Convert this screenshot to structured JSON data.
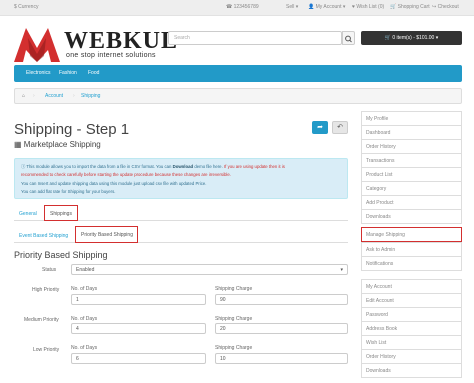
{
  "topbar": {
    "currency": "$ Currency",
    "phone": "123456789",
    "sell": "Sell",
    "account": "My Account",
    "wishlist": "Wish List (0)",
    "cart": "Shopping Cart",
    "checkout": "Checkout"
  },
  "brand": {
    "name": "WEBKUL",
    "tagline": "one stop internet solutions",
    "color": "#d32f2f"
  },
  "search": {
    "placeholder": "Search"
  },
  "cart_button": "0 item(s) - $101.00",
  "menu": [
    "Electronics",
    "Fashion",
    "Food"
  ],
  "breadcrumb": [
    "Account",
    "Shipping"
  ],
  "page": {
    "title": "Shipping - Step 1",
    "subtitle": "Marketplace Shipping"
  },
  "alert": {
    "line1a": "This module allows you to import the data from a file in CSV format. You can",
    "line1b": "Download",
    "line1c": "demo file here.",
    "line1d": "If you are using update then it is",
    "line2": "recommended to check carefully before starting the update procedure because these changes are irreversible.",
    "line3": "You can Insert and update shipping data using this module just upload csv file with updated Price.",
    "line4": "You can add flat rate for Shipping for your buyers."
  },
  "tabs": [
    "General",
    "Shippings"
  ],
  "subtabs": [
    "Event Based Shipping",
    "Priority Based Shipping"
  ],
  "section_title": "Priority Based Shipping",
  "status": {
    "label": "Status",
    "value": "Enabled"
  },
  "rows": [
    {
      "label": "High Priority",
      "days_label": "No. of Days",
      "days": "1",
      "charge_label": "Shipping Charge",
      "charge": "90"
    },
    {
      "label": "Medium Priority",
      "days_label": "No. of Days",
      "days": "4",
      "charge_label": "Shipping Charge",
      "charge": "20"
    },
    {
      "label": "Low Priority",
      "days_label": "No. of Days",
      "days": "6",
      "charge_label": "Shipping Charge",
      "charge": "10"
    }
  ],
  "sidebar1": [
    "My Profile",
    "Dashboard",
    "Order History",
    "Transactions",
    "Product List",
    "Category",
    "Add Product",
    "Downloads",
    "Manage Shipping",
    "Ask to Admin",
    "Notifications"
  ],
  "sidebar2": [
    "My Account",
    "Edit Account",
    "Password",
    "Address Book",
    "Wish List",
    "Order History",
    "Downloads"
  ]
}
